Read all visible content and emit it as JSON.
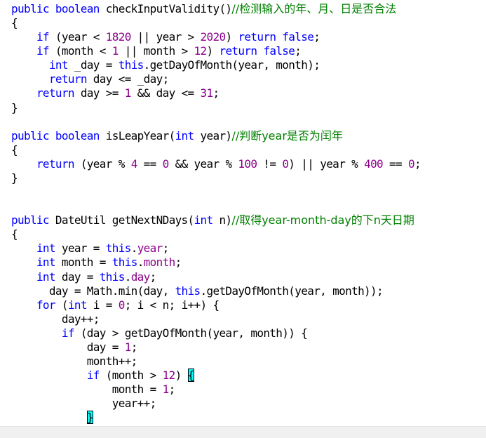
{
  "lines": [
    [
      {
        "t": "public boolean",
        "c": "kw"
      },
      {
        "t": " checkInputValidity()"
      },
      {
        "t": "//检测输入的年、月、日是否合法",
        "c": "cmt"
      }
    ],
    [
      {
        "t": "{"
      }
    ],
    [
      {
        "t": "    "
      },
      {
        "t": "if",
        "c": "kw"
      },
      {
        "t": " (year < "
      },
      {
        "t": "1820",
        "c": "num"
      },
      {
        "t": " || year > "
      },
      {
        "t": "2020",
        "c": "num"
      },
      {
        "t": ") "
      },
      {
        "t": "return false",
        "c": "kw"
      },
      {
        "t": ";"
      }
    ],
    [
      {
        "t": "    "
      },
      {
        "t": "if",
        "c": "kw"
      },
      {
        "t": " (month < "
      },
      {
        "t": "1",
        "c": "num"
      },
      {
        "t": " || month > "
      },
      {
        "t": "12",
        "c": "num"
      },
      {
        "t": ") "
      },
      {
        "t": "return false",
        "c": "kw"
      },
      {
        "t": ";"
      }
    ],
    [
      {
        "t": "      "
      },
      {
        "t": "int",
        "c": "kw"
      },
      {
        "t": " _day = "
      },
      {
        "t": "this",
        "c": "kw"
      },
      {
        "t": ".getDayOfMonth(year, month);"
      }
    ],
    [
      {
        "t": "      "
      },
      {
        "t": "return",
        "c": "kw"
      },
      {
        "t": " day <= _day;"
      }
    ],
    [
      {
        "t": "    "
      },
      {
        "t": "return",
        "c": "kw"
      },
      {
        "t": " day >= "
      },
      {
        "t": "1",
        "c": "num"
      },
      {
        "t": " && day <= "
      },
      {
        "t": "31",
        "c": "num"
      },
      {
        "t": ";"
      }
    ],
    [
      {
        "t": "}"
      }
    ],
    [],
    [
      {
        "t": "public boolean",
        "c": "kw"
      },
      {
        "t": " isLeapYear("
      },
      {
        "t": "int",
        "c": "kw"
      },
      {
        "t": " year)"
      },
      {
        "t": "//判断year是否为闰年",
        "c": "cmt"
      }
    ],
    [
      {
        "t": "{"
      }
    ],
    [
      {
        "t": "    "
      },
      {
        "t": "return",
        "c": "kw"
      },
      {
        "t": " (year % "
      },
      {
        "t": "4",
        "c": "num"
      },
      {
        "t": " == "
      },
      {
        "t": "0",
        "c": "num"
      },
      {
        "t": " && year % "
      },
      {
        "t": "100",
        "c": "num"
      },
      {
        "t": " != "
      },
      {
        "t": "0",
        "c": "num"
      },
      {
        "t": ") || year % "
      },
      {
        "t": "400",
        "c": "num"
      },
      {
        "t": " == "
      },
      {
        "t": "0",
        "c": "num"
      },
      {
        "t": ";"
      }
    ],
    [
      {
        "t": "}"
      }
    ],
    [],
    [],
    [
      {
        "t": "public",
        "c": "kw"
      },
      {
        "t": " DateUtil getNextNDays("
      },
      {
        "t": "int",
        "c": "kw"
      },
      {
        "t": " n)"
      },
      {
        "t": "//取得year-month-day的下n天日期",
        "c": "cmt"
      }
    ],
    [
      {
        "t": "{"
      }
    ],
    [
      {
        "t": "    "
      },
      {
        "t": "int",
        "c": "kw"
      },
      {
        "t": " year = "
      },
      {
        "t": "this",
        "c": "kw"
      },
      {
        "t": "."
      },
      {
        "t": "year",
        "c": "fld"
      },
      {
        "t": ";"
      }
    ],
    [
      {
        "t": "    "
      },
      {
        "t": "int",
        "c": "kw"
      },
      {
        "t": " month = "
      },
      {
        "t": "this",
        "c": "kw"
      },
      {
        "t": "."
      },
      {
        "t": "month",
        "c": "fld"
      },
      {
        "t": ";"
      }
    ],
    [
      {
        "t": "    "
      },
      {
        "t": "int",
        "c": "kw"
      },
      {
        "t": " day = "
      },
      {
        "t": "this",
        "c": "kw"
      },
      {
        "t": "."
      },
      {
        "t": "day",
        "c": "fld"
      },
      {
        "t": ";"
      }
    ],
    [
      {
        "t": "      day = Math.min(day, "
      },
      {
        "t": "this",
        "c": "kw"
      },
      {
        "t": ".getDayOfMonth(year, month));"
      }
    ],
    [
      {
        "t": "    "
      },
      {
        "t": "for",
        "c": "kw"
      },
      {
        "t": " ("
      },
      {
        "t": "int",
        "c": "kw"
      },
      {
        "t": " i = "
      },
      {
        "t": "0",
        "c": "num"
      },
      {
        "t": "; i < n; i++) {"
      }
    ],
    [
      {
        "t": "        day++;"
      }
    ],
    [
      {
        "t": "        "
      },
      {
        "t": "if",
        "c": "kw"
      },
      {
        "t": " (day > getDayOfMonth(year, month)) {"
      }
    ],
    [
      {
        "t": "            day = "
      },
      {
        "t": "1",
        "c": "num"
      },
      {
        "t": ";"
      }
    ],
    [
      {
        "t": "            month++;"
      }
    ],
    [
      {
        "t": "            "
      },
      {
        "t": "if",
        "c": "kw"
      },
      {
        "t": " (month > "
      },
      {
        "t": "12",
        "c": "num"
      },
      {
        "t": ") "
      },
      {
        "t": "{",
        "c": "brace-hl"
      }
    ],
    [
      {
        "t": "                month = "
      },
      {
        "t": "1",
        "c": "num"
      },
      {
        "t": ";"
      }
    ],
    [
      {
        "t": "                year++;"
      }
    ],
    [
      {
        "t": "            "
      },
      {
        "t": "}",
        "c": "brace-hl"
      }
    ]
  ],
  "colors": {
    "keyword": "#0000ff",
    "field": "#8b008b",
    "number": "#8b008b",
    "comment": "#008000",
    "brace_highlight": "#00ffff",
    "background": "#ffffff"
  }
}
